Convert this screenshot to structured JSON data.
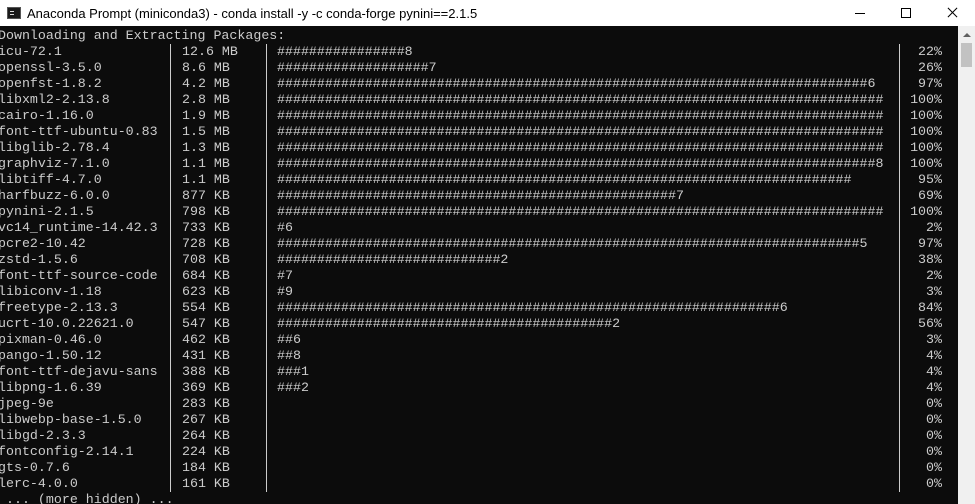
{
  "window": {
    "title": "Anaconda Prompt (miniconda3) - conda  install -y -c conda-forge pynini==2.1.5",
    "icon": "terminal-icon"
  },
  "console": {
    "header": "Downloading and Extracting Packages:",
    "packages": [
      {
        "name": "icu-72.1",
        "size": "12.6 MB",
        "bar": "################8",
        "percent": "22%"
      },
      {
        "name": "openssl-3.5.0",
        "size": "8.6 MB",
        "bar": "###################7",
        "percent": "26%"
      },
      {
        "name": "openfst-1.8.2",
        "size": "4.2 MB",
        "bar": "##########################################################################6",
        "percent": "97%"
      },
      {
        "name": "libxml2-2.13.8",
        "size": "2.8 MB",
        "bar": "############################################################################",
        "percent": "100%"
      },
      {
        "name": "cairo-1.16.0",
        "size": "1.9 MB",
        "bar": "############################################################################",
        "percent": "100%"
      },
      {
        "name": "font-ttf-ubuntu-0.83",
        "size": "1.5 MB",
        "bar": "############################################################################",
        "percent": "100%"
      },
      {
        "name": "libglib-2.78.4",
        "size": "1.3 MB",
        "bar": "############################################################################",
        "percent": "100%"
      },
      {
        "name": "graphviz-7.1.0",
        "size": "1.1 MB",
        "bar": "###########################################################################8",
        "percent": "100%"
      },
      {
        "name": "libtiff-4.7.0",
        "size": "1.1 MB",
        "bar": "########################################################################",
        "percent": "95%"
      },
      {
        "name": "harfbuzz-6.0.0",
        "size": "877 KB",
        "bar": "##################################################7",
        "percent": "69%"
      },
      {
        "name": "pynini-2.1.5",
        "size": "798 KB",
        "bar": "############################################################################",
        "percent": "100%"
      },
      {
        "name": "vc14_runtime-14.42.3",
        "size": "733 KB",
        "bar": "#6",
        "percent": "2%"
      },
      {
        "name": "pcre2-10.42",
        "size": "728 KB",
        "bar": "#########################################################################5",
        "percent": "97%"
      },
      {
        "name": "zstd-1.5.6",
        "size": "708 KB",
        "bar": "############################2",
        "percent": "38%"
      },
      {
        "name": "font-ttf-source-code",
        "size": "684 KB",
        "bar": "#7",
        "percent": "2%"
      },
      {
        "name": "libiconv-1.18",
        "size": "623 KB",
        "bar": "#9",
        "percent": "3%"
      },
      {
        "name": "freetype-2.13.3",
        "size": "554 KB",
        "bar": "###############################################################6",
        "percent": "84%"
      },
      {
        "name": "ucrt-10.0.22621.0",
        "size": "547 KB",
        "bar": "##########################################2",
        "percent": "56%"
      },
      {
        "name": "pixman-0.46.0",
        "size": "462 KB",
        "bar": "##6",
        "percent": "3%"
      },
      {
        "name": "pango-1.50.12",
        "size": "431 KB",
        "bar": "##8",
        "percent": "4%"
      },
      {
        "name": "font-ttf-dejavu-sans",
        "size": "388 KB",
        "bar": "###1",
        "percent": "4%"
      },
      {
        "name": "libpng-1.6.39",
        "size": "369 KB",
        "bar": "###2",
        "percent": "4%"
      },
      {
        "name": "jpeg-9e",
        "size": "283 KB",
        "bar": "",
        "percent": "0%"
      },
      {
        "name": "libwebp-base-1.5.0",
        "size": "267 KB",
        "bar": "",
        "percent": "0%"
      },
      {
        "name": "libgd-2.3.3",
        "size": "264 KB",
        "bar": "",
        "percent": "0%"
      },
      {
        "name": "fontconfig-2.14.1",
        "size": "224 KB",
        "bar": "",
        "percent": "0%"
      },
      {
        "name": "gts-0.7.6",
        "size": "184 KB",
        "bar": "",
        "percent": "0%"
      },
      {
        "name": "lerc-4.0.0",
        "size": "161 KB",
        "bar": "",
        "percent": "0%"
      }
    ],
    "footer": " ... (more hidden) ..."
  }
}
